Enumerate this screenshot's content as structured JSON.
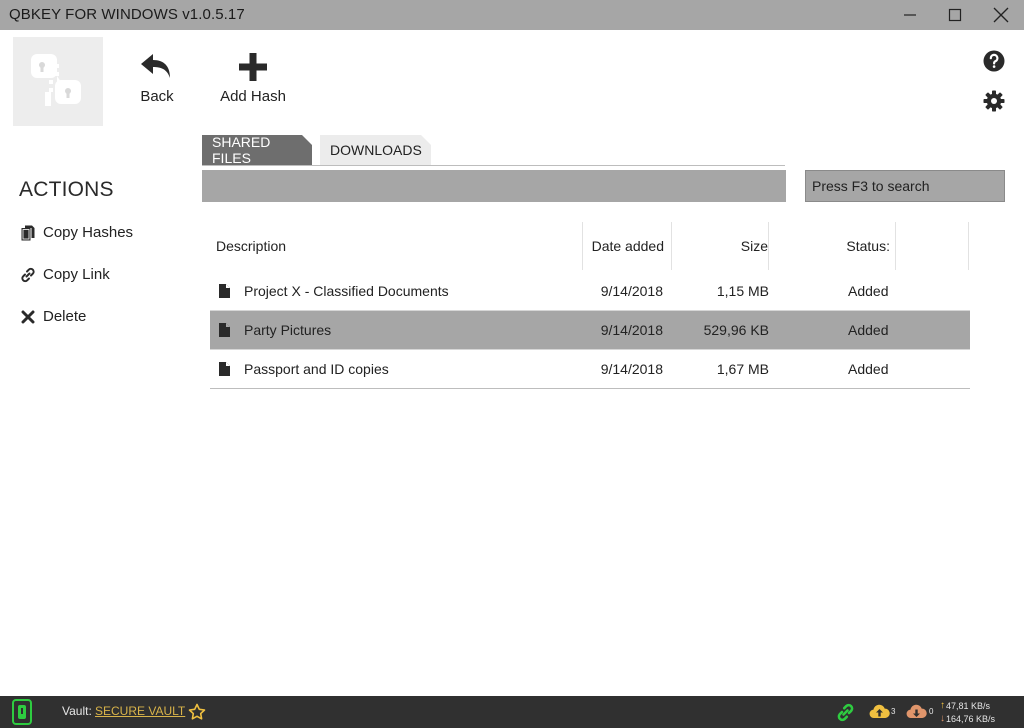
{
  "window": {
    "title": "QBKEY FOR WINDOWS v1.0.5.17",
    "controls": [
      "minimize-icon",
      "maximize-icon",
      "close-icon"
    ]
  },
  "toolbar": {
    "back_label": "Back",
    "add_hash_label": "Add Hash",
    "icons": [
      "back-arrow-icon",
      "plus-icon",
      "help-icon",
      "gear-icon"
    ]
  },
  "actions": {
    "heading": "ACTIONS",
    "items": [
      {
        "label": "Copy Hashes",
        "icon": "copy-icon"
      },
      {
        "label": "Copy Link",
        "icon": "link-icon"
      },
      {
        "label": "Delete",
        "icon": "x-icon"
      }
    ]
  },
  "tabs": [
    {
      "label": "SHARED FILES",
      "active": true
    },
    {
      "label": "DOWNLOADS",
      "active": false
    }
  ],
  "search": {
    "placeholder": "Press F3 to search"
  },
  "table": {
    "columns": [
      "Description",
      "Date added",
      "Size",
      "Status:"
    ],
    "rows": [
      {
        "description": "Project X - Classified Documents",
        "date": "9/14/2018",
        "size": "1,15 MB",
        "status": "Added",
        "selected": false
      },
      {
        "description": "Party Pictures",
        "date": "9/14/2018",
        "size": "529,96 KB",
        "status": "Added",
        "selected": true
      },
      {
        "description": "Passport and ID copies",
        "date": "9/14/2018",
        "size": "1,67 MB",
        "status": "Added",
        "selected": false
      }
    ]
  },
  "statusbar": {
    "vault_label": "Vault:",
    "vault_name": "SECURE VAULT",
    "upload_count": "3",
    "download_count": "0",
    "upload_rate": "47,81 KB/s",
    "download_rate": "164,76 KB/s"
  },
  "colors": {
    "titlebar": "#a6a6a6",
    "active_tab": "#6e6e6e",
    "selected_row": "#a6a6a6",
    "statusbar": "#303030",
    "vault_link": "#d9b44a",
    "green_accent": "#2ecc40",
    "upload_icon": "#f0c040",
    "download_icon": "#e0956b"
  }
}
